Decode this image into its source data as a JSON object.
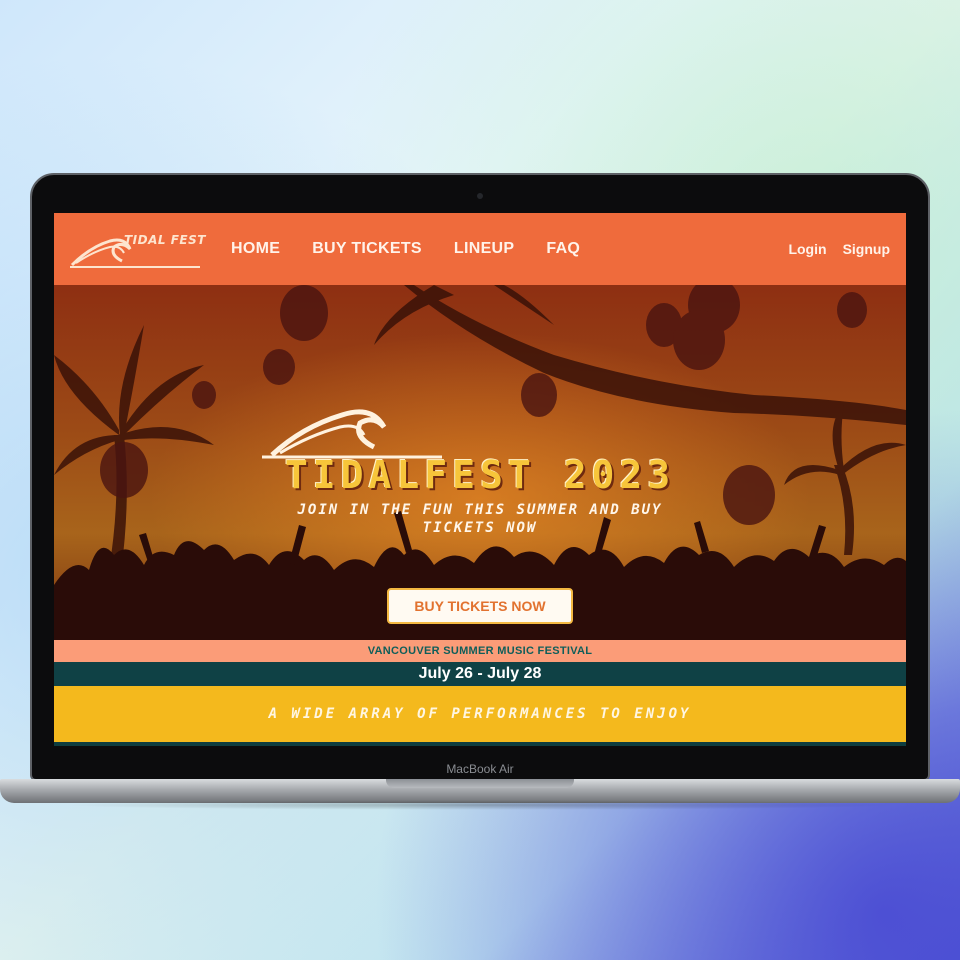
{
  "brand": {
    "logo_text": "TIDAL FEST"
  },
  "nav": {
    "items": [
      "HOME",
      "BUY TICKETS",
      "LINEUP",
      "FAQ"
    ],
    "login": "Login",
    "signup": "Signup"
  },
  "hero": {
    "title": "TIDALFEST 2023",
    "subtitle": "JOIN IN THE FUN THIS SUMMER AND BUY TICKETS NOW",
    "cta": "BUY TICKETS NOW"
  },
  "info": {
    "tagline": "VANCOUVER SUMMER MUSIC FESTIVAL",
    "dates": "July 26 - July 28",
    "performances": "A WIDE ARRAY OF PERFORMANCES TO ENJOY"
  },
  "device": {
    "model": "MacBook Air"
  },
  "colors": {
    "nav": "#ef6b3c",
    "accent_yellow": "#f4b91d",
    "peach": "#fb9c78",
    "teal": "#0f4145"
  }
}
